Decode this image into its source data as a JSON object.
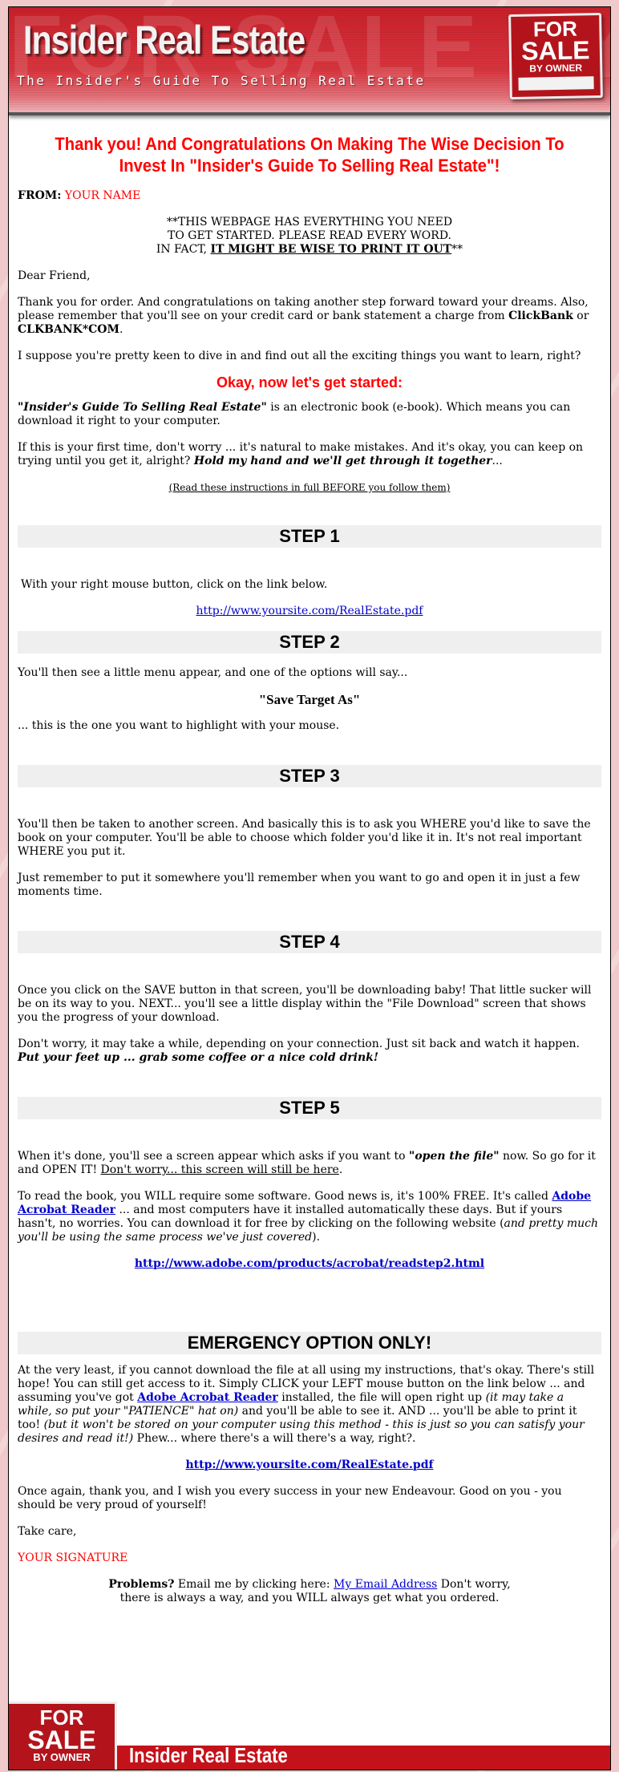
{
  "header": {
    "title": "Insider Real Estate",
    "tagline": "The Insider's Guide To Selling Real Estate",
    "watermark": "FOR SALE BY OWNER",
    "sign": {
      "line1": "FOR",
      "line2": "SALE",
      "line3": "BY OWNER"
    }
  },
  "headline": "Thank you! And Congratulations On Making The Wise Decision To Invest In \"Insider's Guide To Selling Real Estate\"!",
  "from": {
    "label": "FROM:",
    "name": "YOUR NAME"
  },
  "notice": {
    "line1": "**THIS WEBPAGE HAS EVERYTHING YOU NEED",
    "line2": "TO GET STARTED. PLEASE READ EVERY WORD.",
    "line3_prefix": "IN FACT, ",
    "line3_emphasis": "IT MIGHT BE WISE TO PRINT IT OUT",
    "line3_suffix": "**"
  },
  "greeting": "Dear Friend,",
  "intro": {
    "text1": "Thank you for order. And congratulations on taking another step forward toward your dreams. Also, please remember that you'll see on your credit card or bank statement a charge from ",
    "clickbank": "ClickBank",
    "or": " or ",
    "clkbank": "CLKBANK*COM",
    "end": "."
  },
  "suppose": "I suppose you're pretty keen to dive in and find out all the exciting things you want to learn, right?",
  "get_started": "Okay, now let's get started:",
  "ebook": {
    "title": "\"Insider's Guide To Selling Real Estate\"",
    "rest": " is an electronic book (e-book). Which means you can download it right to your computer."
  },
  "first_time": {
    "text": "If this is your first time, don't worry ... it's natural to make mistakes. And it's okay, you can keep on trying until you get it, alright? ",
    "emphasis": "Hold my hand and we'll get through it together",
    "end": "..."
  },
  "read_instructions": "(Read these instructions in full BEFORE you follow them)",
  "steps": [
    {
      "label": "STEP 1",
      "text": "With your right mouse button, click on the link below.",
      "link": "http://www.yoursite.com/RealEstate.pdf"
    },
    {
      "label": "STEP 2",
      "text": "You'll then see a little menu appear, and one of the options will say...",
      "option": "\"Save Target As\"",
      "after": "... this is the one you want to highlight with your mouse."
    },
    {
      "label": "STEP 3",
      "p1": "You'll then be taken to another screen. And basically this is to ask you WHERE you'd like to save the book on your computer. You'll be able to choose which folder you'd like it in. It's not real important WHERE you put it.",
      "p2": "Just remember to put it somewhere you'll remember when you want to go and open it in just a few moments time."
    },
    {
      "label": "STEP 4",
      "p1": "Once you click on the SAVE button in that screen, you'll be downloading baby! That little sucker will be on its way to you. NEXT... you'll see a little display within the \"File Download\" screen that shows you the progress of your download.",
      "p2": "Don't worry, it may take a while, depending on your connection. Just sit back and watch it happen. ",
      "p2_emphasis": "Put your feet up ... grab some coffee or a nice cold drink!"
    },
    {
      "label": "STEP 5",
      "p1a": "When it's done, you'll see a screen appear which asks if you want to ",
      "p1_emphasis": "\"open the file\"",
      "p1b": " now. So go for it and OPEN IT! ",
      "p1_underline": "Don't worry... this screen will still be here",
      "p1_end": ".",
      "p2a": "To read the book, you WILL require some software. Good news is, it's 100% FREE. It's called ",
      "p2_link": "Adobe Acrobat Reader",
      "p2b": " ... and most computers have it installed automatically these days. But if yours hasn't, no worries. You can download it for free by clicking on the following website (",
      "p2_italic": "and pretty much you'll be using the same process we've just covered",
      "p2_end": ").",
      "link": "http://www.adobe.com/products/acrobat/readstep2.html"
    }
  ],
  "emergency": {
    "label": "EMERGENCY OPTION ONLY!",
    "p1a": "At the very least, if you cannot download the file at all using my instructions, that's okay. There's still hope! You can still get access to it. Simply CLICK your LEFT mouse button on the link below ... and assuming you've got ",
    "p1_link": "Adobe Acrobat Reader",
    "p1b": " installed, the file will open right up ",
    "p1_italic1": "(it may take a while, so put your \"PATIENCE\" hat on)",
    "p1c": " and you'll be able to see it. AND ... you'll be able to print it too! ",
    "p1_italic2": "(but it won't be stored on your computer using this method - this is just so you can satisfy your desires and read it!)",
    "p1d": " Phew... where there's a will there's a way, right?.",
    "link": "http://www.yoursite.com/RealEstate.pdf"
  },
  "closing": "Once again, thank you, and I wish you every success in your new Endeavour. Good on you - you should be very proud of yourself!",
  "take_care": "Take care,",
  "signature": "YOUR SIGNATURE",
  "problems": {
    "label": "Problems?",
    "text1": " Email me by clicking here: ",
    "link": "My Email Address",
    "text2": " Don't worry,",
    "line2": "there is always a way, and you WILL always get what you ordered."
  },
  "footer": {
    "title": "Insider Real Estate",
    "sign": {
      "line1": "FOR",
      "line2": "SALE",
      "line3": "BY OWNER"
    }
  },
  "colors": {
    "accent_red": "#ff0000",
    "link_blue": "#0000cc",
    "banner_red": "#c4121a",
    "page_bg": "#f0c9ca",
    "step_bar_bg": "#efefef"
  }
}
